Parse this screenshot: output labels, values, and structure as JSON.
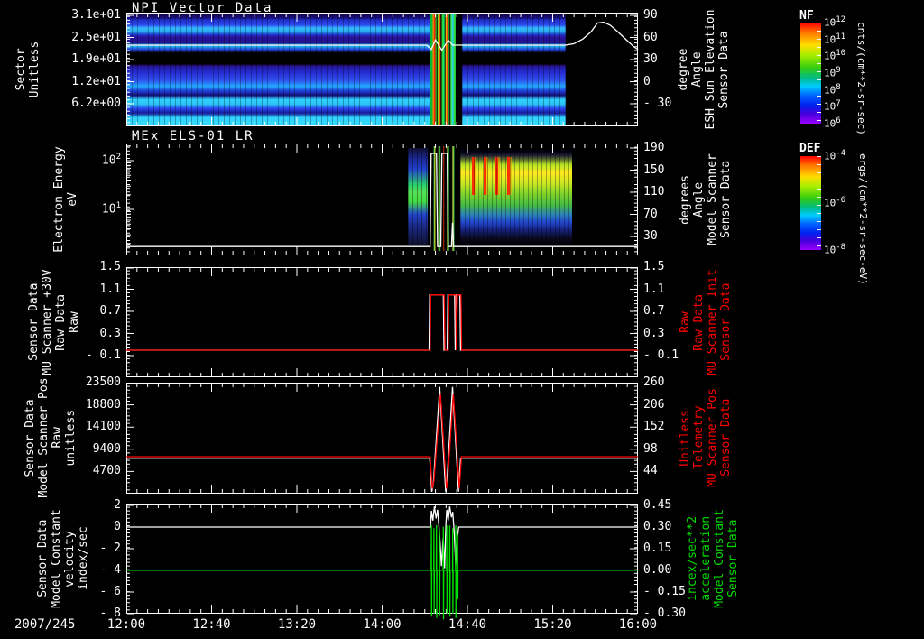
{
  "date_label": "2007/245",
  "x_axis": {
    "ticks": [
      "12:00",
      "12:40",
      "13:20",
      "14:00",
      "14:40",
      "15:20",
      "16:00"
    ]
  },
  "colors": {
    "axis": "#ffffff",
    "red_series": "#ff0000",
    "green_series": "#00dd00",
    "white_series": "#ffffff"
  },
  "panels": [
    {
      "id": "npi",
      "title": "NPI Vector Data",
      "left_label_lines": [
        "Sector",
        "Unitless"
      ],
      "yticks": [
        "3.1e+01",
        "2.5e+01",
        "1.9e+01",
        "1.2e+01",
        "6.2e+00"
      ],
      "right_ticks": [
        "90",
        "60",
        "30",
        "0",
        "- 30"
      ],
      "right_label_lines": [
        "Sensor Data",
        "ESH Sun Elevation",
        "Angle",
        "degree"
      ],
      "right_label_color": "#ffffff"
    },
    {
      "id": "els",
      "title": "MEx ELS-01 LR",
      "left_label_lines": [
        "Electron Energy",
        "eV"
      ],
      "ytick_exponents": [
        2,
        1
      ],
      "right_ticks": [
        "190",
        "150",
        "110",
        "70",
        "30"
      ],
      "right_label_lines": [
        "Sensor Data",
        "Model Scanner",
        "Angle",
        "degrees"
      ],
      "right_label_color": "#ffffff"
    },
    {
      "id": "scanner30v",
      "left_label_lines": [
        "Sensor Data",
        "MU Scanner +30V",
        "Raw Data",
        "Raw"
      ],
      "yticks": [
        "1.5",
        "1.1",
        "0.7",
        "0.3",
        "- 0.1"
      ],
      "right_ticks": [
        "1.5",
        "1.1",
        "0.7",
        "0.3",
        "- 0.1"
      ],
      "right_label_lines": [
        "Sensor Data",
        "MU Scanner Init",
        "Raw Data",
        "Raw"
      ],
      "right_label_color": "#ff0000"
    },
    {
      "id": "scannerpos",
      "left_label_lines": [
        "Sensor Data",
        "Model Scanner Pos",
        "Raw",
        "unitless"
      ],
      "yticks": [
        "23500",
        "18800",
        "14100",
        "9400",
        "4700"
      ],
      "right_ticks": [
        "260",
        "206",
        "152",
        "98",
        "44"
      ],
      "right_label_lines": [
        "Sensor Data",
        "MU Scanner Pos",
        "Telemetry",
        "Unitless"
      ],
      "right_label_color": "#ff0000"
    },
    {
      "id": "velocity",
      "left_label_lines": [
        "Sensor Data",
        "Model Constant",
        "velocity",
        "index/sec"
      ],
      "yticks": [
        "2",
        "0",
        "- 2",
        "- 4",
        "- 6",
        "- 8"
      ],
      "right_ticks": [
        "0.45",
        "0.30",
        "0.15",
        "0.00",
        "- 0.15",
        "- 0.30"
      ],
      "right_label_lines": [
        "Sensor Data",
        "Model Constant",
        "acceleration",
        "incex/sec**2"
      ],
      "right_label_color": "#00dd00"
    }
  ],
  "colorbars": [
    {
      "label": "NF",
      "units": "cnts/(cm**2-sr-sec)",
      "tick_exponents": [
        12,
        11,
        10,
        9,
        8,
        7,
        6
      ]
    },
    {
      "label": "DEF",
      "units": "ergs/(cm**2-sr-sec-eV)",
      "tick_exponents": [
        -4,
        -6,
        -8
      ]
    }
  ],
  "chart_data": [
    {
      "type": "heatmap",
      "panel": "npi",
      "title": "NPI Vector Data",
      "xlabel_range": [
        "12:00",
        "16:00"
      ],
      "xlim_minutes": [
        0,
        240
      ],
      "ylabel": "Sector Unitless",
      "ylim": [
        0,
        32
      ],
      "ytick_values": [
        31,
        25,
        19,
        12,
        6.2
      ],
      "right_axis": {
        "label": "ESH Sun Elevation Angle degree",
        "tick_values": [
          90,
          60,
          30,
          0,
          -30
        ],
        "lim": [
          -60,
          94
        ]
      },
      "features": {
        "data_end_min": 206,
        "disturbance_min": [
          142.5,
          154.5
        ],
        "post_disturbance_gap_min": [
          154.5,
          157.5
        ]
      },
      "overlay_series": {
        "name": "ESH Sun Elevation Angle",
        "color": "#ffffff",
        "axis": "right",
        "points": [
          [
            0,
            50
          ],
          [
            141,
            50
          ],
          [
            143,
            44
          ],
          [
            145,
            57
          ],
          [
            148,
            43
          ],
          [
            151,
            57
          ],
          [
            153,
            50
          ],
          [
            206,
            50
          ],
          [
            210,
            52
          ],
          [
            214,
            58
          ],
          [
            218,
            68
          ],
          [
            221,
            80
          ],
          [
            224,
            81
          ],
          [
            227,
            77
          ],
          [
            231,
            67
          ],
          [
            235,
            56
          ],
          [
            238,
            48
          ],
          [
            240,
            44
          ]
        ]
      }
    },
    {
      "type": "heatmap",
      "panel": "els",
      "title": "MEx ELS-01 LR",
      "xlim_minutes": [
        0,
        240
      ],
      "ylabel": "Electron Energy eV",
      "yscale": "log",
      "ylim": [
        1.2,
        220
      ],
      "ytick_values": [
        10,
        100
      ],
      "right_axis": {
        "label": "Model Scanner Angle degrees",
        "tick_values": [
          190,
          150,
          110,
          70,
          30
        ],
        "lim": [
          -4,
          198
        ]
      },
      "features": {
        "quiet_until_min": 132,
        "patch_min": [
          132,
          141.5
        ],
        "disturbance_strips_min": [
          142.5,
          155.5
        ],
        "main_region_min": [
          156.5,
          209
        ],
        "black_after_min": 209
      },
      "overlay_series": {
        "name": "Model Scanner Angle",
        "color": "#ffffff",
        "axis": "right",
        "points": [
          [
            0,
            12
          ],
          [
            142.5,
            12
          ],
          [
            143,
            180
          ],
          [
            145.5,
            180
          ],
          [
            146,
            12
          ],
          [
            147.5,
            12
          ],
          [
            148,
            180
          ],
          [
            150.5,
            180
          ],
          [
            151,
            12
          ],
          [
            152.5,
            12
          ],
          [
            153,
            55
          ],
          [
            153.5,
            12
          ],
          [
            240,
            12
          ]
        ]
      }
    },
    {
      "type": "line",
      "panel": "scanner30v",
      "xlim_minutes": [
        0,
        240
      ],
      "ylim": [
        -0.49,
        1.5
      ],
      "series": [
        {
          "name": "MU Scanner +30V Raw Data Raw",
          "color": "#ffffff",
          "axis": "left",
          "points": [
            [
              0,
              0
            ],
            [
              142.0,
              0
            ],
            [
              142.3,
              1.0
            ],
            [
              148.7,
              1.0
            ],
            [
              149.0,
              0.0
            ],
            [
              150.5,
              0.0
            ],
            [
              150.8,
              1.0
            ],
            [
              154.0,
              1.0
            ],
            [
              154.3,
              0.0
            ],
            [
              154.8,
              1.0
            ],
            [
              156.5,
              1.0
            ],
            [
              156.8,
              0
            ],
            [
              240,
              0
            ]
          ]
        },
        {
          "name": "MU Scanner Init Raw Data Raw",
          "color": "#ff0000",
          "axis": "right",
          "ylim": [
            -0.49,
            1.5
          ],
          "points": [
            [
              0,
              0
            ],
            [
              142.5,
              0
            ],
            [
              142.8,
              1.0
            ],
            [
              149.1,
              1.0
            ],
            [
              149.5,
              0.0
            ],
            [
              151.0,
              0.0
            ],
            [
              151.3,
              1.0
            ],
            [
              154.5,
              1.0
            ],
            [
              154.8,
              0.0
            ],
            [
              155.3,
              1.0
            ],
            [
              157.0,
              1.0
            ],
            [
              157.3,
              0
            ],
            [
              240,
              0
            ]
          ]
        }
      ]
    },
    {
      "type": "line",
      "panel": "scannerpos",
      "xlim_minutes": [
        0,
        240
      ],
      "ylim": [
        0,
        23500
      ],
      "series": [
        {
          "name": "Model Scanner Pos Raw unitless",
          "color": "#ffffff",
          "axis": "left",
          "points": [
            [
              0,
              7500
            ],
            [
              142.3,
              7500
            ],
            [
              143.3,
              400
            ],
            [
              144.0,
              2000
            ],
            [
              147.0,
              22600
            ],
            [
              149.8,
              400
            ],
            [
              150.3,
              2000
            ],
            [
              153.0,
              22600
            ],
            [
              155.8,
              400
            ],
            [
              156.8,
              7500
            ],
            [
              240,
              7500
            ]
          ]
        },
        {
          "name": "MU Scanner Pos Telemetry Unitless",
          "color": "#ff0000",
          "axis": "right",
          "ylim": [
            -10,
            260
          ],
          "points": [
            [
              0,
              80
            ],
            [
              142.5,
              80
            ],
            [
              143.5,
              2
            ],
            [
              144.3,
              20
            ],
            [
              147.4,
              232
            ],
            [
              150.2,
              2
            ],
            [
              150.7,
              20
            ],
            [
              153.4,
              232
            ],
            [
              156.2,
              2
            ],
            [
              157.2,
              80
            ],
            [
              240,
              80
            ]
          ]
        }
      ]
    },
    {
      "type": "line",
      "panel": "velocity",
      "xlim_minutes": [
        0,
        240
      ],
      "ylim": [
        -8,
        2.17
      ],
      "series": [
        {
          "name": "Model Constant velocity index/sec",
          "color": "#ffffff",
          "axis": "left",
          "points": [
            [
              0,
              0
            ],
            [
              142.7,
              0
            ],
            [
              143.1,
              1.5
            ],
            [
              143.8,
              0.6
            ],
            [
              144.5,
              1.9
            ],
            [
              145.3,
              0.8
            ],
            [
              146.0,
              1.6
            ],
            [
              146.6,
              0.2
            ],
            [
              147.2,
              -1.5
            ],
            [
              147.8,
              -3.6
            ],
            [
              148.6,
              -1.0
            ],
            [
              149.3,
              -3.8
            ],
            [
              149.9,
              0.2
            ],
            [
              150.3,
              1.6
            ],
            [
              151.0,
              0.6
            ],
            [
              151.7,
              1.9
            ],
            [
              152.5,
              0.9
            ],
            [
              153.1,
              1.4
            ],
            [
              153.8,
              -0.5
            ],
            [
              154.5,
              -3.5
            ],
            [
              155.3,
              -1.0
            ],
            [
              155.9,
              0
            ],
            [
              240,
              0
            ]
          ]
        },
        {
          "name": "Model Constant acceleration index/sec**2",
          "color": "#00dd00",
          "axis": "right",
          "ylim": [
            -0.3,
            0.46
          ],
          "points": [
            [
              0,
              0
            ],
            [
              143.0,
              0
            ],
            [
              143.1,
              0.31
            ],
            [
              143.2,
              -0.32
            ],
            [
              143.3,
              0
            ],
            [
              144.2,
              0
            ],
            [
              144.3,
              0.29
            ],
            [
              144.4,
              -0.3
            ],
            [
              144.5,
              0
            ],
            [
              145.4,
              0
            ],
            [
              145.5,
              0.31
            ],
            [
              145.6,
              -0.33
            ],
            [
              145.7,
              0
            ],
            [
              146.8,
              0
            ],
            [
              146.9,
              0.28
            ],
            [
              147.0,
              -0.31
            ],
            [
              147.1,
              0
            ],
            [
              148.6,
              0
            ],
            [
              148.7,
              0.3
            ],
            [
              148.8,
              -0.34
            ],
            [
              148.9,
              0
            ],
            [
              150.2,
              0
            ],
            [
              150.3,
              0.31
            ],
            [
              150.4,
              -0.3
            ],
            [
              150.5,
              0
            ],
            [
              151.6,
              0
            ],
            [
              151.7,
              0.31
            ],
            [
              151.8,
              -0.32
            ],
            [
              151.9,
              0
            ],
            [
              153.0,
              0
            ],
            [
              153.1,
              0.29
            ],
            [
              153.2,
              -0.3
            ],
            [
              153.3,
              0
            ],
            [
              154.4,
              0
            ],
            [
              154.5,
              0.31
            ],
            [
              154.6,
              -0.33
            ],
            [
              154.7,
              0
            ],
            [
              155.3,
              0
            ],
            [
              155.4,
              0.25
            ],
            [
              155.5,
              -0.2
            ],
            [
              155.6,
              0
            ],
            [
              240,
              0
            ]
          ]
        }
      ]
    }
  ]
}
